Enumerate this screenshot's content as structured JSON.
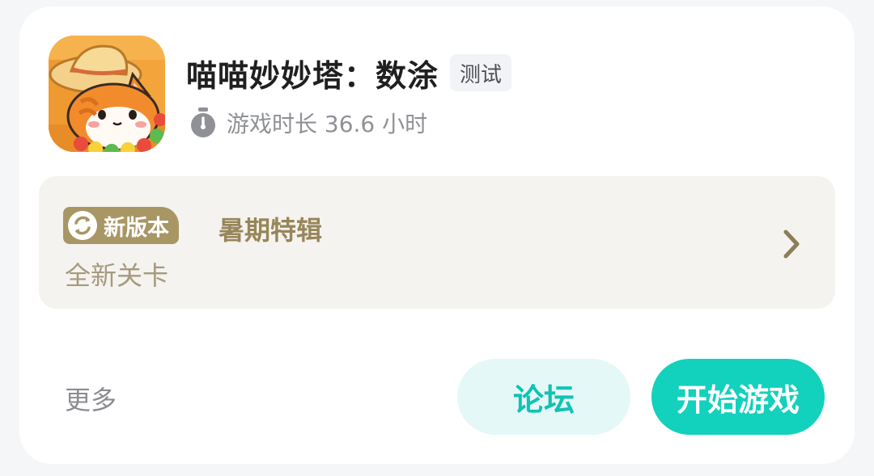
{
  "game": {
    "title": "喵喵妙妙塔：数涂",
    "tag": "测试",
    "playtime": "游戏时长 36.6 小时",
    "icon": "cat-with-straw-hat-icon"
  },
  "update": {
    "badge_label": "新版本",
    "title": "暑期特辑",
    "subtitle": "全新关卡"
  },
  "actions": {
    "more_label": "更多",
    "forum_label": "论坛",
    "play_label": "开始游戏"
  },
  "colors": {
    "accent": "#12d1bd",
    "accent_soft": "#e5f8f8",
    "badge": "#a89665",
    "panel": "#f5f3ef"
  }
}
